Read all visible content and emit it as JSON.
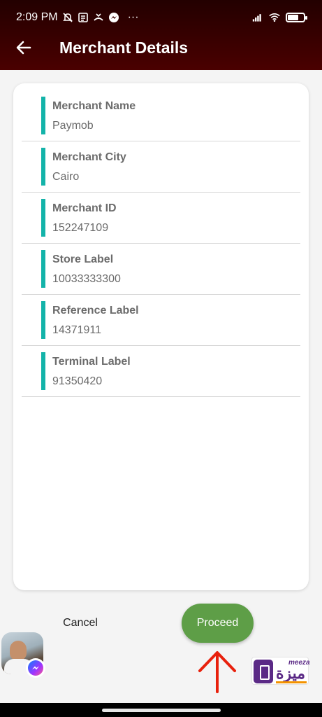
{
  "status_bar": {
    "time": "2:09 PM",
    "more": "···",
    "battery_level": 0.7,
    "icons": [
      "mute-bell-icon",
      "newspaper-icon",
      "call-forward-icon",
      "messenger-icon",
      "signal-icon",
      "wifi-icon",
      "battery-icon"
    ]
  },
  "app_bar": {
    "title": "Merchant Details",
    "back_icon": "arrow-left-icon"
  },
  "details": [
    {
      "label": "Merchant Name",
      "value": "Paymob"
    },
    {
      "label": "Merchant City",
      "value": "Cairo"
    },
    {
      "label": "Merchant ID",
      "value": "152247109"
    },
    {
      "label": "Store Label",
      "value": "10033333300"
    },
    {
      "label": "Reference Label",
      "value": "14371911"
    },
    {
      "label": "Terminal Label",
      "value": "91350420"
    }
  ],
  "actions": {
    "cancel": "Cancel",
    "proceed": "Proceed"
  },
  "overlay": {
    "chat_head_icon": "messenger-icon",
    "arrow_icon": "red-up-arrow-icon",
    "meeza_logo_latin": "meeza",
    "meeza_logo_arabic": "ميزة"
  },
  "colors": {
    "header": "#3a0000",
    "accent_bar": "#13b3a9",
    "proceed_button": "#5e9e47",
    "arrow": "#e8200c",
    "meeza_purple": "#5b2a86"
  }
}
